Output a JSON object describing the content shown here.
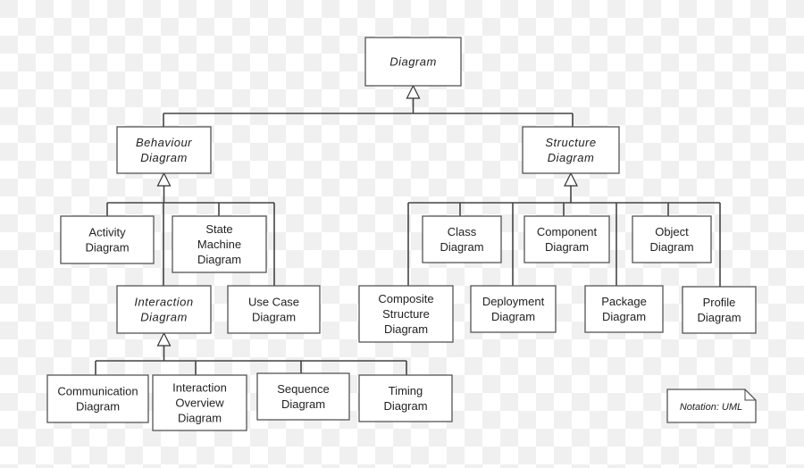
{
  "nodes": [
    {
      "id": "diagram",
      "lines": [
        "Diagram"
      ],
      "abstract": true
    },
    {
      "id": "behaviour",
      "lines": [
        "Behaviour",
        "Diagram"
      ],
      "abstract": true
    },
    {
      "id": "structure",
      "lines": [
        "Structure",
        "Diagram"
      ],
      "abstract": true
    },
    {
      "id": "activity",
      "lines": [
        "Activity",
        "Diagram"
      ],
      "abstract": false
    },
    {
      "id": "state-machine",
      "lines": [
        "State",
        "Machine",
        "Diagram"
      ],
      "abstract": false
    },
    {
      "id": "interaction",
      "lines": [
        "Interaction",
        "Diagram"
      ],
      "abstract": true
    },
    {
      "id": "use-case",
      "lines": [
        "Use Case",
        "Diagram"
      ],
      "abstract": false
    },
    {
      "id": "communication",
      "lines": [
        "Communication",
        "Diagram"
      ],
      "abstract": false
    },
    {
      "id": "interaction-overview",
      "lines": [
        "Interaction",
        "Overview",
        "Diagram"
      ],
      "abstract": false
    },
    {
      "id": "sequence",
      "lines": [
        "Sequence",
        "Diagram"
      ],
      "abstract": false
    },
    {
      "id": "timing",
      "lines": [
        "Timing",
        "Diagram"
      ],
      "abstract": false
    },
    {
      "id": "class",
      "lines": [
        "Class",
        "Diagram"
      ],
      "abstract": false
    },
    {
      "id": "component",
      "lines": [
        "Component",
        "Diagram"
      ],
      "abstract": false
    },
    {
      "id": "object",
      "lines": [
        "Object",
        "Diagram"
      ],
      "abstract": false
    },
    {
      "id": "composite-structure",
      "lines": [
        "Composite",
        "Structure",
        "Diagram"
      ],
      "abstract": false
    },
    {
      "id": "deployment",
      "lines": [
        "Deployment",
        "Diagram"
      ],
      "abstract": false
    },
    {
      "id": "package",
      "lines": [
        "Package",
        "Diagram"
      ],
      "abstract": false
    },
    {
      "id": "profile",
      "lines": [
        "Profile",
        "Diagram"
      ],
      "abstract": false
    }
  ],
  "edges": [
    {
      "parent": "diagram",
      "children": [
        "behaviour",
        "structure"
      ]
    },
    {
      "parent": "behaviour",
      "children": [
        "activity",
        "state-machine",
        "interaction",
        "use-case"
      ]
    },
    {
      "parent": "interaction",
      "children": [
        "communication",
        "interaction-overview",
        "sequence",
        "timing"
      ]
    },
    {
      "parent": "structure",
      "children": [
        "class",
        "component",
        "object",
        "composite-structure",
        "deployment",
        "package",
        "profile"
      ]
    }
  ],
  "note": "Notation: UML"
}
